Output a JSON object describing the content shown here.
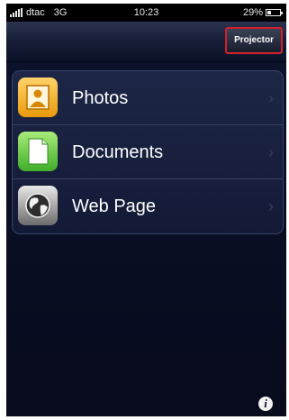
{
  "status_bar": {
    "carrier": "dtac",
    "network": "3G",
    "time": "10:23",
    "battery": "29%",
    "battery_level": 0.29
  },
  "nav_bar": {
    "projector_label": "Projector"
  },
  "menu": {
    "items": [
      {
        "label": "Photos",
        "icon": "photos-icon",
        "color": "#f5b021"
      },
      {
        "label": "Documents",
        "icon": "documents-icon",
        "color": "#5cc23c"
      },
      {
        "label": "Web Page",
        "icon": "globe-icon",
        "color": "#9a9a9a"
      }
    ]
  },
  "footer": {
    "info_icon": "info-icon"
  },
  "colors": {
    "background": "#0a0f26",
    "highlight_border": "#d4202a"
  }
}
